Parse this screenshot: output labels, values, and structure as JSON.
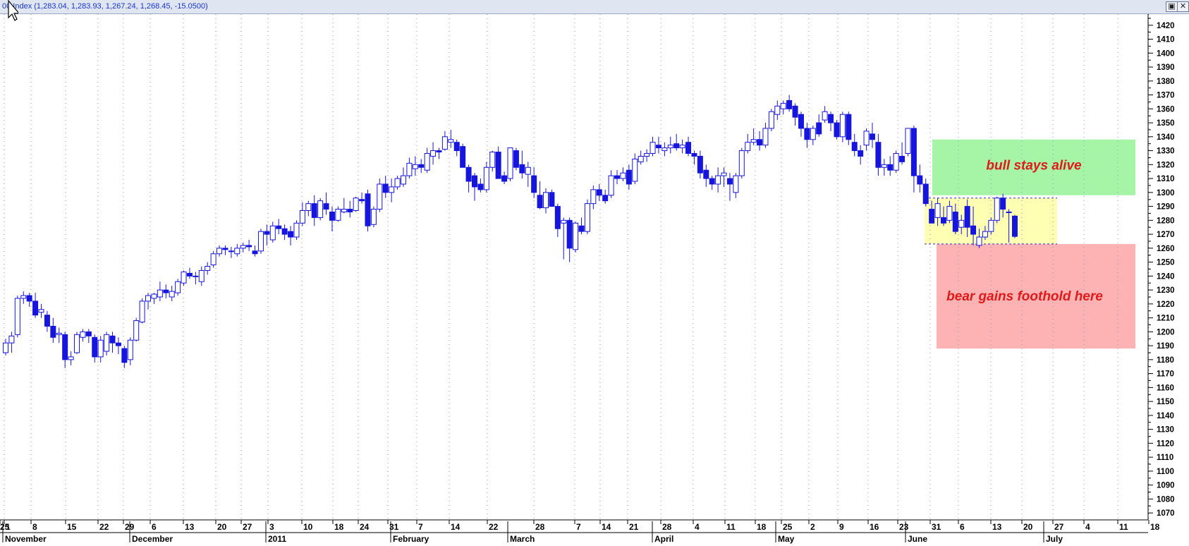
{
  "window": {
    "title": "00 Index",
    "readout": "(1,283.04, 1,283.93, 1,267.24, 1,268.45, -15.0500)",
    "restore_icon": "restore-icon",
    "close_icon": "close-icon"
  },
  "colors": {
    "candle": "#1515dd",
    "grid": "#8c98b2",
    "bull_zone": "#a6f5a6",
    "bear_zone": "#fdb3b3",
    "range_zone": "#ffffb4",
    "annotation_text": "#e01a1a"
  },
  "chart_data": {
    "type": "candlestick",
    "title": "",
    "xlabel": "",
    "ylabel": "",
    "ylim": [
      1065,
      1428
    ],
    "y_ticks": [
      1070,
      1080,
      1090,
      1100,
      1110,
      1120,
      1130,
      1140,
      1150,
      1160,
      1170,
      1180,
      1190,
      1200,
      1210,
      1220,
      1230,
      1240,
      1250,
      1260,
      1270,
      1280,
      1290,
      1300,
      1310,
      1320,
      1330,
      1340,
      1350,
      1360,
      1370,
      1380,
      1390,
      1400,
      1410,
      1420
    ],
    "x_day_labels": [
      "1",
      "8",
      "15",
      "22",
      "29",
      "6",
      "13",
      "20",
      "27",
      "3",
      "10",
      "18",
      "24",
      "31",
      "7",
      "14",
      "22",
      "28",
      "7",
      "14",
      "21",
      "28",
      "4",
      "11",
      "18",
      "25",
      "2",
      "9",
      "16",
      "23",
      "31",
      "6",
      "13",
      "20",
      "27",
      "4",
      "11",
      "18",
      "25"
    ],
    "x_month_labels": [
      "November",
      "December",
      "2011",
      "February",
      "March",
      "April",
      "May",
      "June",
      "July"
    ],
    "grid": true,
    "series": [
      {
        "ohlc": [
          [
            1185,
            1195,
            1183,
            1192
          ],
          [
            1192,
            1200,
            1185,
            1197
          ],
          [
            1198,
            1226,
            1196,
            1224
          ],
          [
            1224,
            1229,
            1220,
            1226
          ],
          [
            1226,
            1228,
            1218,
            1222
          ],
          [
            1222,
            1228,
            1210,
            1212
          ],
          [
            1214,
            1220,
            1210,
            1216
          ],
          [
            1212,
            1215,
            1200,
            1204
          ],
          [
            1204,
            1210,
            1192,
            1196
          ],
          [
            1198,
            1203,
            1192,
            1199
          ],
          [
            1198,
            1200,
            1174,
            1180
          ],
          [
            1180,
            1186,
            1176,
            1182
          ],
          [
            1185,
            1200,
            1184,
            1198
          ],
          [
            1196,
            1202,
            1193,
            1200
          ],
          [
            1200,
            1202,
            1192,
            1197
          ],
          [
            1196,
            1198,
            1178,
            1182
          ],
          [
            1182,
            1197,
            1178,
            1194
          ],
          [
            1186,
            1200,
            1183,
            1198
          ],
          [
            1197,
            1200,
            1185,
            1192
          ],
          [
            1192,
            1196,
            1184,
            1190
          ],
          [
            1188,
            1190,
            1174,
            1178
          ],
          [
            1180,
            1196,
            1176,
            1194
          ],
          [
            1194,
            1210,
            1193,
            1208
          ],
          [
            1207,
            1224,
            1206,
            1222
          ],
          [
            1222,
            1228,
            1216,
            1226
          ],
          [
            1224,
            1228,
            1220,
            1227
          ],
          [
            1225,
            1236,
            1222,
            1230
          ],
          [
            1230,
            1234,
            1224,
            1228
          ],
          [
            1225,
            1233,
            1222,
            1229
          ],
          [
            1228,
            1238,
            1226,
            1236
          ],
          [
            1235,
            1244,
            1233,
            1243
          ],
          [
            1242,
            1246,
            1238,
            1240
          ],
          [
            1240,
            1243,
            1234,
            1240
          ],
          [
            1236,
            1247,
            1233,
            1244
          ],
          [
            1244,
            1250,
            1241,
            1247
          ],
          [
            1248,
            1258,
            1246,
            1256
          ],
          [
            1256,
            1262,
            1254,
            1260
          ],
          [
            1260,
            1262,
            1255,
            1259
          ],
          [
            1258,
            1261,
            1253,
            1258
          ],
          [
            1256,
            1263,
            1254,
            1260
          ],
          [
            1260,
            1264,
            1257,
            1262
          ],
          [
            1262,
            1266,
            1258,
            1261
          ],
          [
            1258,
            1262,
            1254,
            1256
          ],
          [
            1258,
            1274,
            1256,
            1272
          ],
          [
            1272,
            1277,
            1262,
            1270
          ],
          [
            1266,
            1279,
            1264,
            1276
          ],
          [
            1276,
            1281,
            1270,
            1274
          ],
          [
            1274,
            1277,
            1266,
            1270
          ],
          [
            1272,
            1276,
            1262,
            1268
          ],
          [
            1268,
            1280,
            1266,
            1278
          ],
          [
            1278,
            1293,
            1276,
            1287
          ],
          [
            1287,
            1294,
            1283,
            1292
          ],
          [
            1292,
            1298,
            1276,
            1282
          ],
          [
            1282,
            1296,
            1280,
            1294
          ],
          [
            1292,
            1300,
            1284,
            1288
          ],
          [
            1286,
            1290,
            1272,
            1280
          ],
          [
            1280,
            1290,
            1279,
            1288
          ],
          [
            1286,
            1296,
            1285,
            1288
          ],
          [
            1288,
            1294,
            1282,
            1286
          ],
          [
            1287,
            1297,
            1286,
            1296
          ],
          [
            1295,
            1300,
            1292,
            1294
          ],
          [
            1299,
            1302,
            1272,
            1276
          ],
          [
            1277,
            1290,
            1275,
            1288
          ],
          [
            1288,
            1310,
            1286,
            1306
          ],
          [
            1306,
            1312,
            1296,
            1300
          ],
          [
            1300,
            1310,
            1293,
            1304
          ],
          [
            1304,
            1312,
            1302,
            1310
          ],
          [
            1306,
            1318,
            1304,
            1312
          ],
          [
            1312,
            1325,
            1310,
            1321
          ],
          [
            1317,
            1326,
            1312,
            1320
          ],
          [
            1320,
            1324,
            1314,
            1318
          ],
          [
            1316,
            1332,
            1314,
            1328
          ],
          [
            1326,
            1336,
            1320,
            1330
          ],
          [
            1330,
            1332,
            1324,
            1329
          ],
          [
            1331,
            1344,
            1330,
            1340
          ],
          [
            1336,
            1345,
            1332,
            1338
          ],
          [
            1336,
            1338,
            1326,
            1330
          ],
          [
            1333,
            1335,
            1318,
            1318
          ],
          [
            1318,
            1320,
            1300,
            1308
          ],
          [
            1312,
            1314,
            1294,
            1304
          ],
          [
            1306,
            1310,
            1300,
            1302
          ],
          [
            1302,
            1322,
            1300,
            1318
          ],
          [
            1318,
            1330,
            1315,
            1329
          ],
          [
            1329,
            1333,
            1310,
            1310
          ],
          [
            1312,
            1315,
            1306,
            1308
          ],
          [
            1310,
            1332,
            1308,
            1332
          ],
          [
            1330,
            1332,
            1316,
            1318
          ],
          [
            1320,
            1330,
            1310,
            1314
          ],
          [
            1313,
            1322,
            1304,
            1318
          ],
          [
            1312,
            1318,
            1296,
            1300
          ],
          [
            1298,
            1308,
            1288,
            1289
          ],
          [
            1289,
            1303,
            1285,
            1300
          ],
          [
            1300,
            1302,
            1290,
            1290
          ],
          [
            1290,
            1292,
            1268,
            1274
          ],
          [
            1278,
            1282,
            1252,
            1280
          ],
          [
            1280,
            1282,
            1250,
            1260
          ],
          [
            1259,
            1279,
            1257,
            1278
          ],
          [
            1276,
            1282,
            1270,
            1272
          ],
          [
            1272,
            1295,
            1270,
            1292
          ],
          [
            1292,
            1305,
            1288,
            1302
          ],
          [
            1302,
            1306,
            1294,
            1298
          ],
          [
            1298,
            1302,
            1292,
            1294
          ],
          [
            1298,
            1316,
            1296,
            1312
          ],
          [
            1312,
            1316,
            1306,
            1310
          ],
          [
            1310,
            1318,
            1308,
            1314
          ],
          [
            1316,
            1320,
            1302,
            1306
          ],
          [
            1308,
            1328,
            1306,
            1324
          ],
          [
            1322,
            1330,
            1320,
            1326
          ],
          [
            1326,
            1331,
            1322,
            1328
          ],
          [
            1328,
            1340,
            1326,
            1336
          ],
          [
            1334,
            1340,
            1328,
            1332
          ],
          [
            1330,
            1336,
            1326,
            1332
          ],
          [
            1332,
            1340,
            1328,
            1334
          ],
          [
            1335,
            1342,
            1330,
            1332
          ],
          [
            1332,
            1338,
            1328,
            1334
          ],
          [
            1336,
            1340,
            1326,
            1328
          ],
          [
            1328,
            1330,
            1320,
            1326
          ],
          [
            1326,
            1330,
            1310,
            1314
          ],
          [
            1316,
            1320,
            1304,
            1310
          ],
          [
            1310,
            1312,
            1302,
            1306
          ],
          [
            1306,
            1318,
            1300,
            1312
          ],
          [
            1312,
            1318,
            1304,
            1314
          ],
          [
            1310,
            1314,
            1294,
            1306
          ],
          [
            1300,
            1314,
            1296,
            1312
          ],
          [
            1312,
            1332,
            1310,
            1330
          ],
          [
            1330,
            1342,
            1328,
            1336
          ],
          [
            1336,
            1346,
            1334,
            1338
          ],
          [
            1338,
            1344,
            1330,
            1334
          ],
          [
            1334,
            1350,
            1332,
            1346
          ],
          [
            1346,
            1360,
            1344,
            1358
          ],
          [
            1356,
            1366,
            1352,
            1362
          ],
          [
            1360,
            1366,
            1356,
            1364
          ],
          [
            1366,
            1370,
            1358,
            1360
          ],
          [
            1362,
            1364,
            1348,
            1354
          ],
          [
            1356,
            1358,
            1340,
            1346
          ],
          [
            1346,
            1350,
            1332,
            1338
          ],
          [
            1338,
            1348,
            1334,
            1346
          ],
          [
            1350,
            1356,
            1340,
            1342
          ],
          [
            1352,
            1362,
            1350,
            1358
          ],
          [
            1356,
            1358,
            1344,
            1350
          ],
          [
            1350,
            1352,
            1338,
            1340
          ],
          [
            1340,
            1358,
            1336,
            1356
          ],
          [
            1356,
            1358,
            1334,
            1338
          ],
          [
            1336,
            1342,
            1326,
            1330
          ],
          [
            1330,
            1334,
            1320,
            1326
          ],
          [
            1334,
            1346,
            1330,
            1344
          ],
          [
            1342,
            1350,
            1332,
            1338
          ],
          [
            1336,
            1342,
            1312,
            1318
          ],
          [
            1318,
            1324,
            1312,
            1320
          ],
          [
            1320,
            1326,
            1312,
            1316
          ],
          [
            1316,
            1330,
            1314,
            1328
          ],
          [
            1326,
            1336,
            1320,
            1322
          ],
          [
            1328,
            1346,
            1326,
            1346
          ],
          [
            1346,
            1348,
            1300,
            1312
          ],
          [
            1312,
            1320,
            1300,
            1306
          ],
          [
            1306,
            1310,
            1290,
            1292
          ],
          [
            1288,
            1294,
            1278,
            1278
          ],
          [
            1282,
            1296,
            1276,
            1292
          ],
          [
            1282,
            1290,
            1276,
            1278
          ],
          [
            1280,
            1294,
            1278,
            1290
          ],
          [
            1286,
            1292,
            1270,
            1272
          ],
          [
            1275,
            1284,
            1270,
            1280
          ],
          [
            1290,
            1295,
            1268,
            1275
          ],
          [
            1276,
            1290,
            1262,
            1270
          ],
          [
            1262,
            1274,
            1260,
            1268
          ],
          [
            1268,
            1276,
            1266,
            1272
          ],
          [
            1272,
            1282,
            1270,
            1280
          ],
          [
            1280,
            1297,
            1278,
            1296
          ],
          [
            1296,
            1299,
            1282,
            1288
          ],
          [
            1286,
            1288,
            1264,
            1286
          ],
          [
            1283.04,
            1283.93,
            1267.24,
            1268.45
          ]
        ]
      }
    ],
    "annotations": [
      {
        "text": "bull stays alive",
        "zone": "bull_zone"
      },
      {
        "text": "bear gains foothold here",
        "zone": "bear_zone"
      }
    ]
  }
}
